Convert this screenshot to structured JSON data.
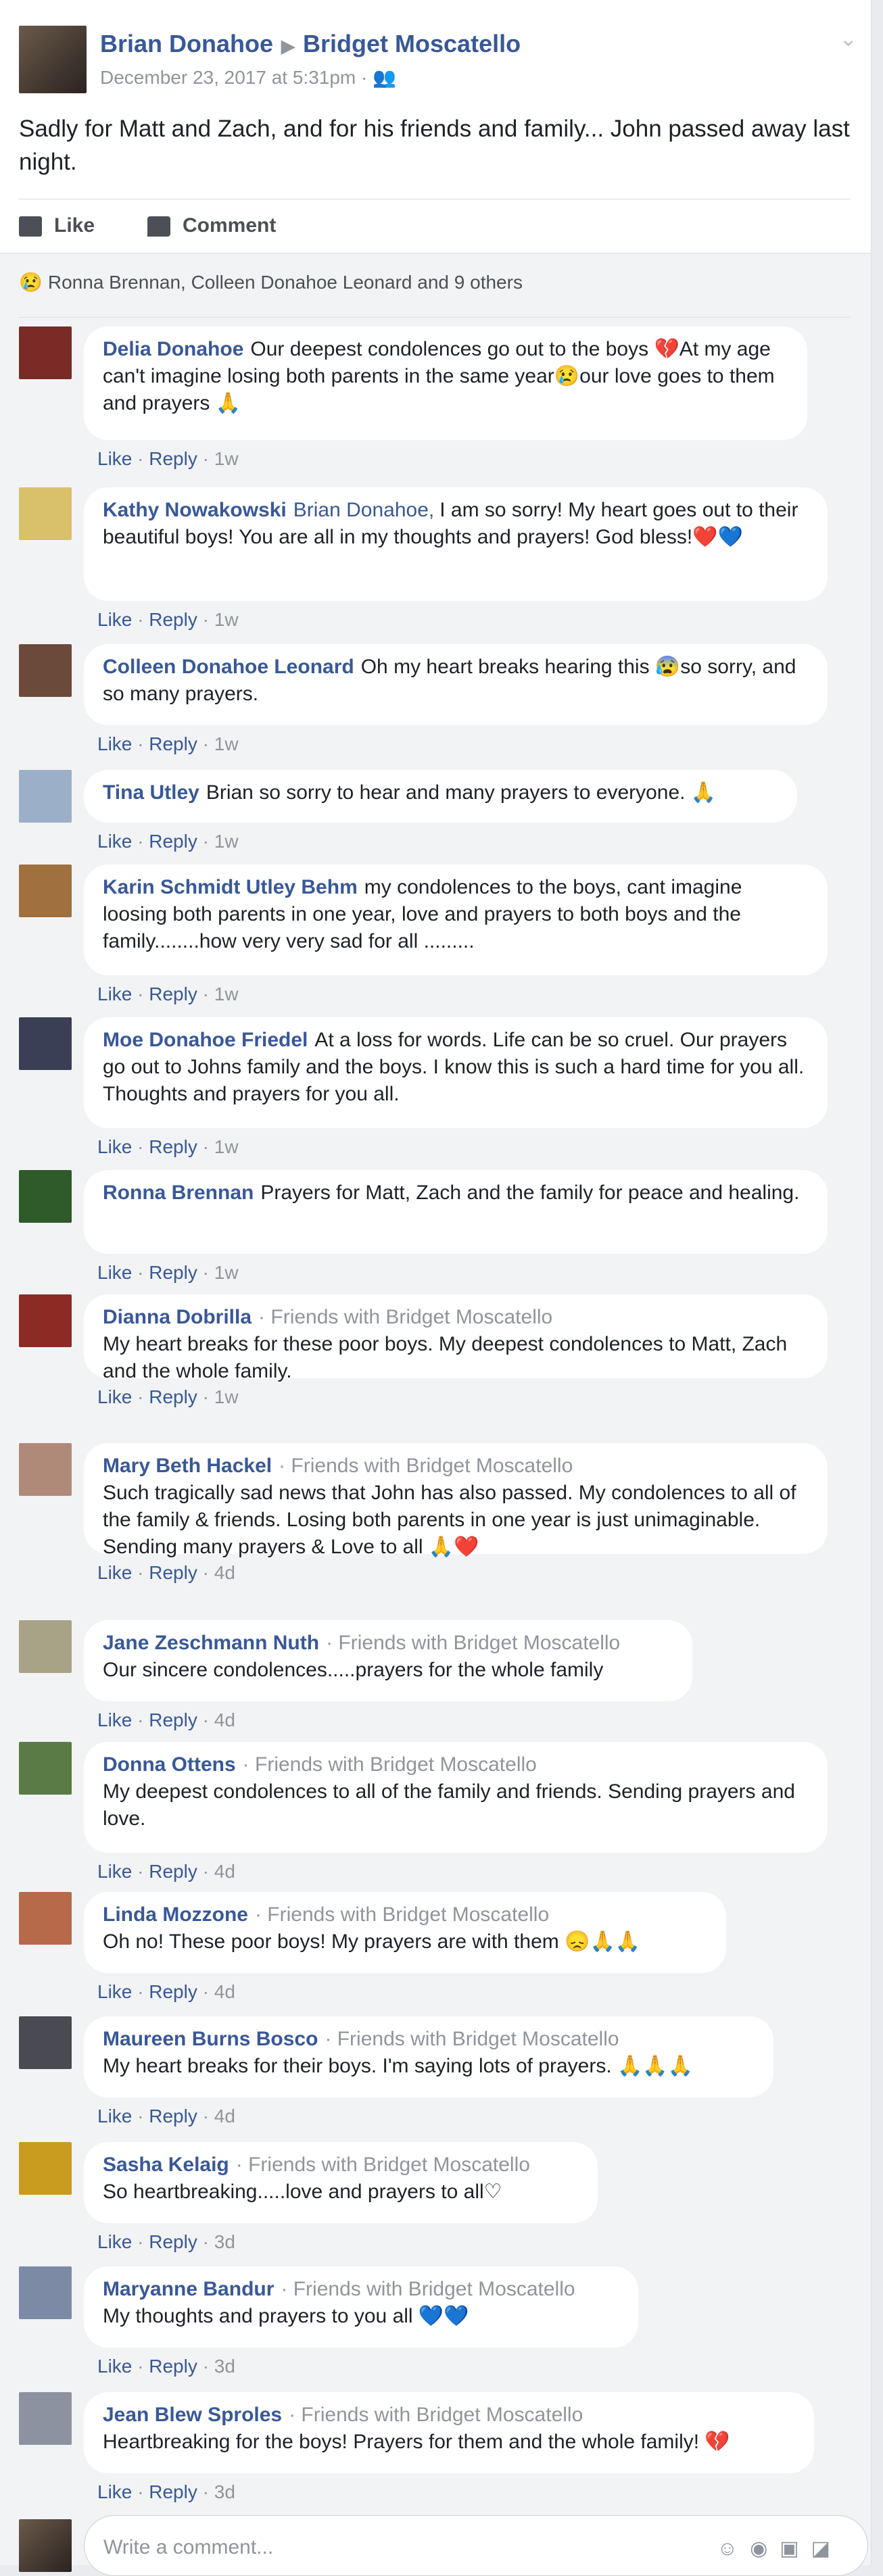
{
  "post": {
    "author": "Brian Donahoe",
    "arrow": "▶",
    "target": "Bridget Moscatello",
    "timestamp": "December 23, 2017 at 5:31pm · ",
    "privacy_icon": "friends-icon",
    "text": "Sadly for Matt and Zach, and for his friends and family... John passed away last night.",
    "actions": {
      "like": "Like",
      "comment": "Comment"
    }
  },
  "reactions": {
    "emoji": "😢",
    "text": "Ronna Brennan, Colleen Donahoe Leonard and 9 others"
  },
  "comments": [
    {
      "author": "Delia Donahoe",
      "tag": "",
      "friends": "",
      "text": "Our deepest condolences go out to the boys 💔At my age can't imagine losing both parents in the same year😢our love goes to them and prayers 🙏",
      "time": "1w"
    },
    {
      "author": "Kathy Nowakowski",
      "tag": "Brian Donahoe,",
      "friends": "",
      "text": "I am so sorry! My heart goes out to their beautiful boys! You are all in my thoughts and prayers! God bless!❤️💙",
      "time": "1w"
    },
    {
      "author": "Colleen Donahoe Leonard",
      "tag": "",
      "friends": "",
      "text": "Oh my heart breaks hearing this 😰so sorry, and so many prayers.",
      "time": "1w"
    },
    {
      "author": "Tina Utley",
      "tag": "",
      "friends": "",
      "text": "Brian so sorry to hear and many prayers to everyone. 🙏",
      "time": "1w"
    },
    {
      "author": "Karin Schmidt Utley Behm",
      "tag": "",
      "friends": "",
      "text": "my condolences to the boys, cant imagine loosing both parents in one year, love and prayers to both boys and the family........how very very sad for all .........",
      "time": "1w"
    },
    {
      "author": "Moe Donahoe Friedel",
      "tag": "",
      "friends": "",
      "text": "At a loss for words. Life can be so cruel. Our prayers go out to Johns family and the boys. I know this is such a hard time for you all. Thoughts and prayers for you all.",
      "time": "1w"
    },
    {
      "author": "Ronna Brennan",
      "tag": "",
      "friends": "",
      "text": "Prayers for Matt, Zach and the family for peace and healing.",
      "time": "1w"
    },
    {
      "author": "Dianna Dobrilla",
      "tag": "",
      "friends": "· Friends with Bridget Moscatello",
      "text": "My heart breaks for these poor boys. My deepest condolences to Matt, Zach and the whole family.",
      "time": "1w"
    },
    {
      "author": "Mary Beth Hackel",
      "tag": "",
      "friends": "· Friends with Bridget Moscatello",
      "text": "Such tragically sad news that John has also passed. My condolences to all of the family & friends. Losing both parents in one year is just unimaginable. Sending many prayers & Love to all 🙏❤️",
      "time": "4d"
    },
    {
      "author": "Jane Zeschmann Nuth",
      "tag": "",
      "friends": "· Friends with Bridget Moscatello",
      "text": "Our sincere condolences.....prayers for the whole family",
      "time": "4d"
    },
    {
      "author": "Donna Ottens",
      "tag": "",
      "friends": "· Friends with Bridget Moscatello",
      "text": "My deepest condolences to all of the family and friends. Sending prayers and love.",
      "time": "4d"
    },
    {
      "author": "Linda Mozzone",
      "tag": "",
      "friends": "· Friends with Bridget Moscatello",
      "text": "Oh no! These poor boys! My prayers are with them 😞🙏🙏",
      "time": "4d"
    },
    {
      "author": "Maureen Burns Bosco",
      "tag": "",
      "friends": "· Friends with Bridget Moscatello",
      "text": "My heart breaks for their boys. I'm saying lots of prayers. 🙏🙏🙏",
      "time": "4d"
    },
    {
      "author": "Sasha Kelaig",
      "tag": "",
      "friends": "· Friends with Bridget Moscatello",
      "text": "So heartbreaking.....love and prayers to all♡",
      "time": "3d"
    },
    {
      "author": "Maryanne Bandur",
      "tag": "",
      "friends": "· Friends with Bridget Moscatello",
      "text": "My thoughts and prayers to you all 💙💙",
      "time": "3d"
    },
    {
      "author": "Jean Blew Sproles",
      "tag": "",
      "friends": "· Friends with Bridget Moscatello",
      "text": "Heartbreaking for the boys! Prayers for them and the whole family! 💔",
      "time": "3d"
    }
  ],
  "comment_actions": {
    "like": "Like",
    "sep": " · ",
    "reply": "Reply"
  },
  "write": {
    "placeholder": "Write a comment...",
    "icons": [
      "emoji-icon",
      "camera-icon",
      "gif-icon",
      "sticker-icon"
    ]
  },
  "colors": {
    "link": "#385898",
    "muted": "#90949c",
    "bubble": "#ffffff",
    "background": "#f2f3f5"
  }
}
